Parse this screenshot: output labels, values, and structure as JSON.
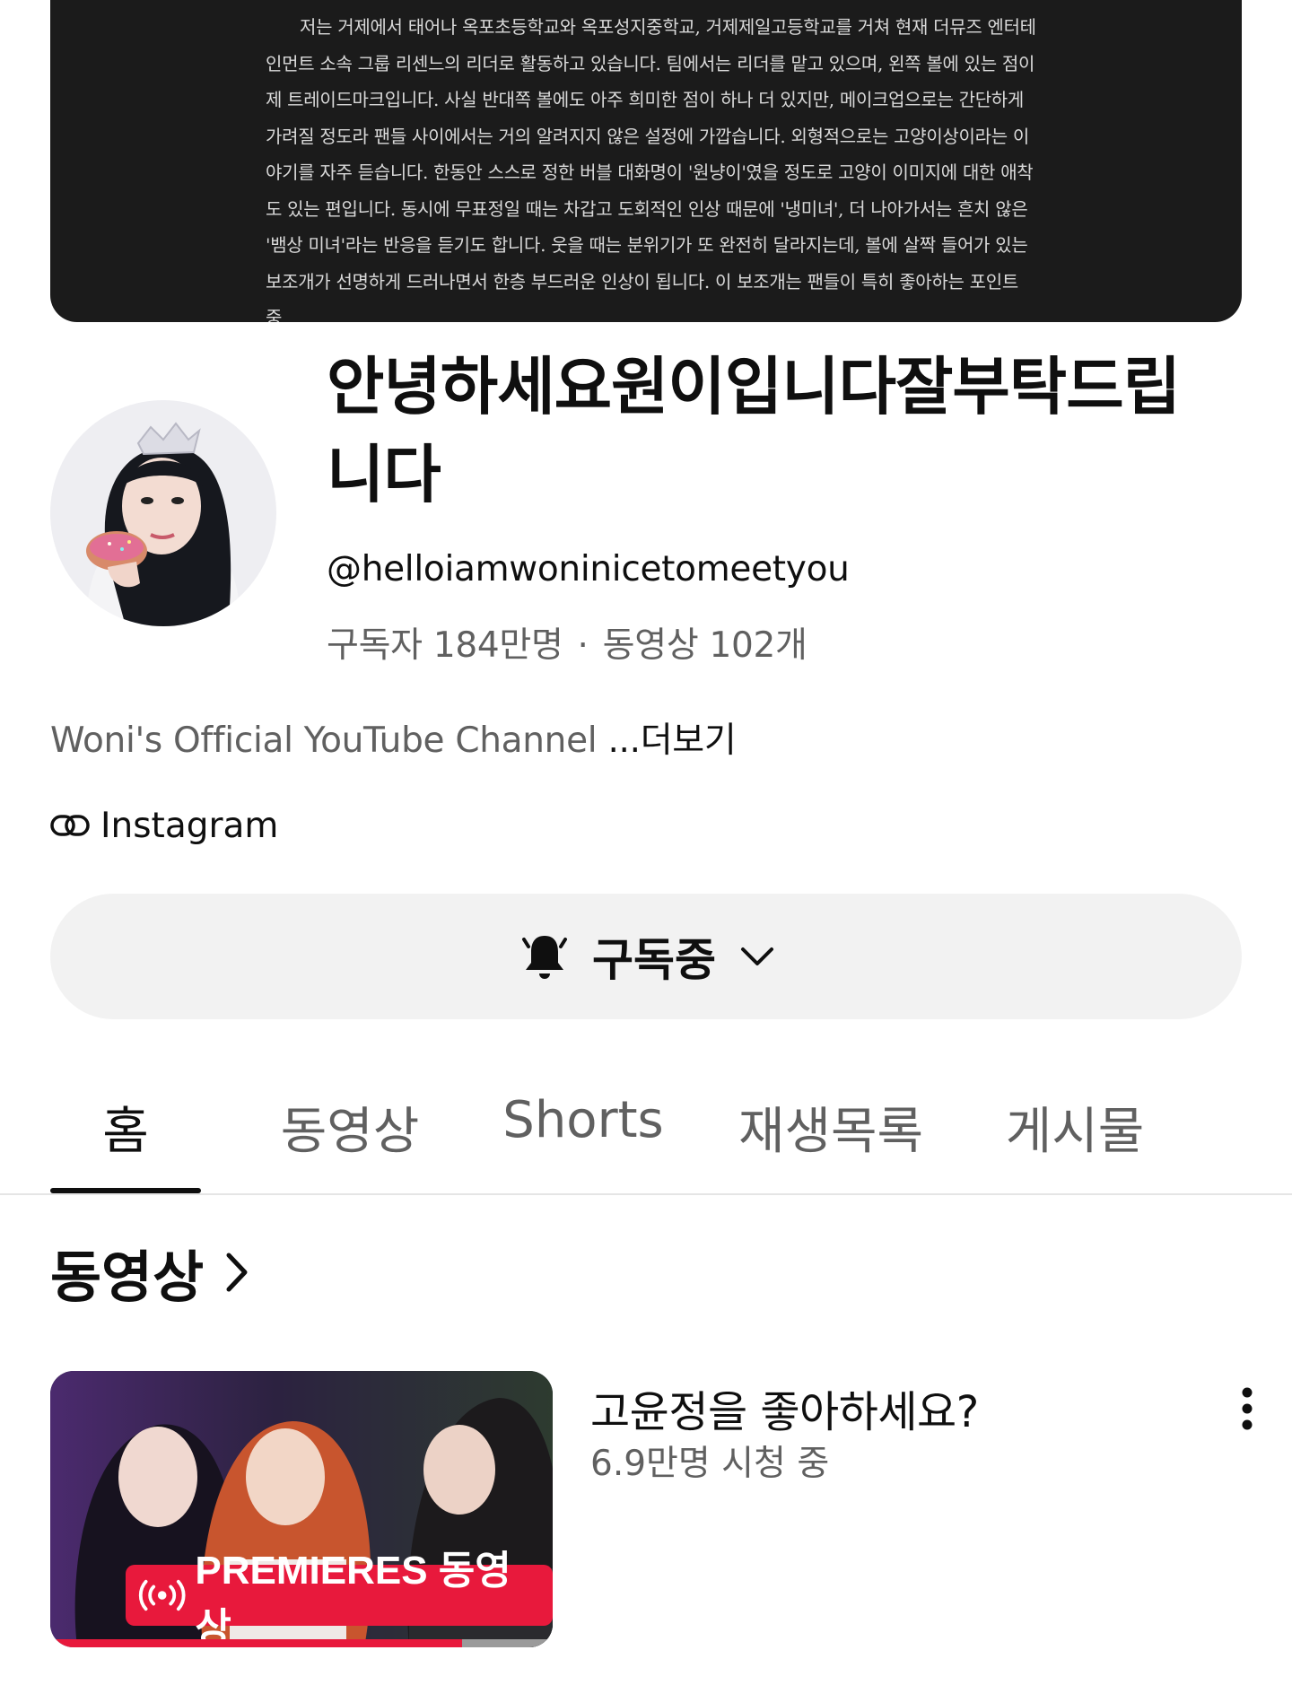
{
  "banner": {
    "text": "저는 거제에서 태어나 옥포초등학교와 옥포성지중학교, 거제제일고등학교를 거쳐 현재 더뮤즈 엔터테인먼트 소속 그룹 리센느의 리더로 활동하고 있습니다. 팀에서는 리더를 맡고 있으며, 왼쪽 볼에 있는 점이 제 트레이드마크입니다. 사실 반대쪽 볼에도 아주 희미한 점이 하나 더 있지만, 메이크업으로는 간단하게 가려질 정도라 팬들 사이에서는 거의 알려지지 않은 설정에 가깝습니다. 외형적으로는 고양이상이라는 이야기를 자주 듣습니다. 한동안 스스로 정한 버블 대화명이 '원냥이'였을 정도로 고양이 이미지에 대한 애착도 있는 편입니다. 동시에 무표정일 때는 차갑고 도회적인 인상 때문에 '냉미녀', 더 나아가서는 흔치 않은 '뱀상 미녀'라는 반응을 듣기도 합니다. 웃을 때는 분위기가 또 완전히 달라지는데, 볼에 살짝 들어가 있는 보조개가 선명하게 드러나면서 한층 부드러운 인상이 됩니다. 이 보조개는 팬들이 특히 좋아하는 포인트 중"
  },
  "channel": {
    "name": "안녕하세요원이입니다잘부탁드립니다",
    "handle": "@helloiamwoninicetomeetyou",
    "subscribers": "구독자 184만명",
    "separator": "·",
    "videos": "동영상 102개",
    "description": "Woni's Official YouTube Channel ",
    "more_label": "...더보기",
    "link_label": "Instagram"
  },
  "subscribe": {
    "label": "구독중"
  },
  "tabs": [
    {
      "label": "홈"
    },
    {
      "label": "동영상"
    },
    {
      "label": "Shorts"
    },
    {
      "label": "재생목록"
    },
    {
      "label": "게시물"
    }
  ],
  "section": {
    "title": "동영상"
  },
  "video": {
    "title": "고윤정을 좋아하세요?",
    "meta": "6.9만명 시청 중",
    "badge": "PREMIERES 동영상",
    "progress": 0.82
  },
  "icons": {
    "link": "link-icon",
    "bell": "bell-icon",
    "chevron_down": "chevron-down-icon",
    "chevron_right": "chevron-right-icon",
    "broadcast": "broadcast-icon",
    "more": "more-vert-icon"
  },
  "colors": {
    "accent_red": "#e8193c",
    "secondary_text": "#606060",
    "button_bg": "#f2f2f2"
  }
}
